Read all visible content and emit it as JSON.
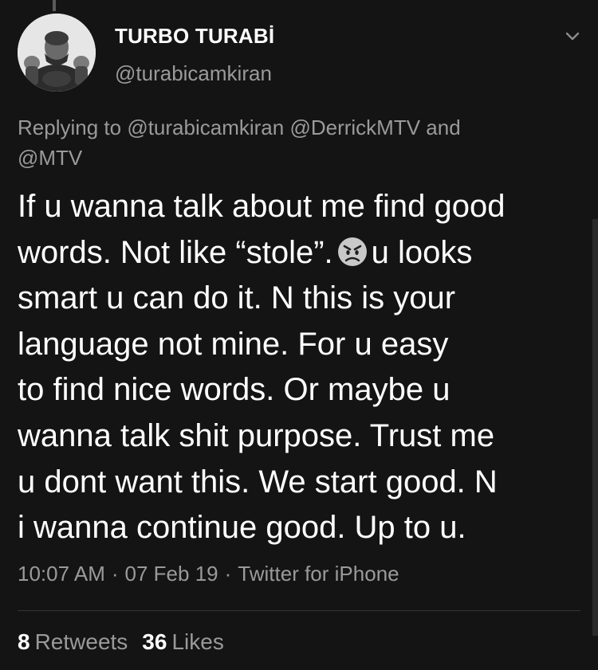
{
  "author": {
    "display_name": "TURBO TURABİ",
    "handle": "@turabicamkiran",
    "avatar_icon": "profile-photo"
  },
  "reply": {
    "prefix": "Replying to",
    "mentions_line1": "@turabicamkiran @DerrickMTV and",
    "mentions_line2": "@MTV"
  },
  "tweet": {
    "lines": [
      "If u wanna talk about me find good",
      "words. Not like “stole”.",
      "u looks",
      "smart u can do it. N this is your",
      "language not mine. For u easy",
      "to find nice words. Or maybe u",
      "wanna talk shit purpose. Trust me",
      "u dont want this. We start good. N",
      "i wanna continue good. Up to u."
    ],
    "emoji": "angry-face-icon"
  },
  "meta": {
    "time": "10:07 AM",
    "date": "07 Feb 19",
    "source": "Twitter for iPhone",
    "separator": "·"
  },
  "stats": {
    "retweets_count": "8",
    "retweets_label": "Retweets",
    "likes_count": "36",
    "likes_label": "Likes"
  },
  "colors": {
    "background": "#141414",
    "text": "#ffffff",
    "secondary_text": "#9a9a9a",
    "divider": "#333333"
  }
}
